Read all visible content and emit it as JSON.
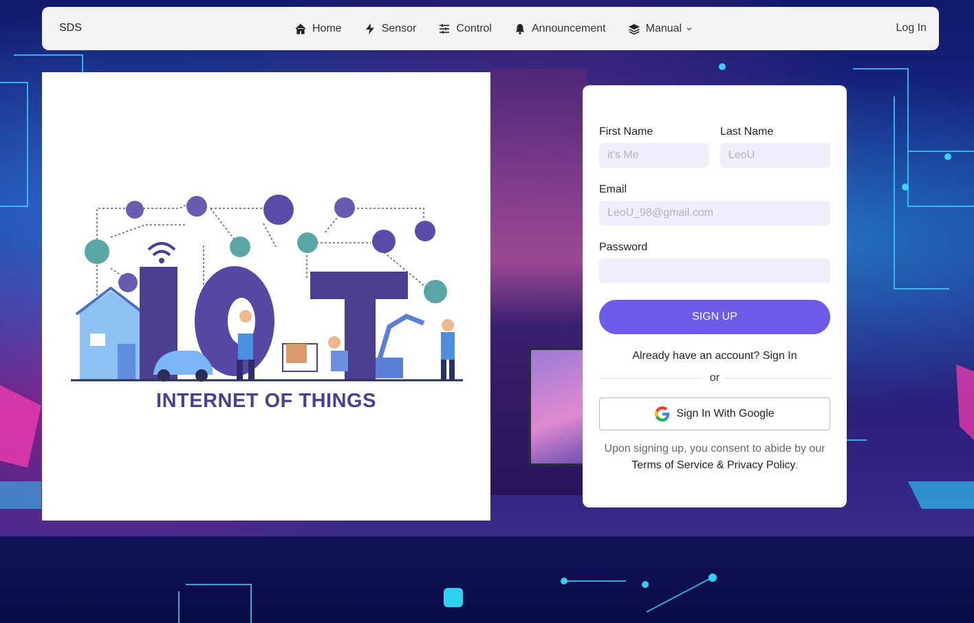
{
  "navbar": {
    "brand": "SDS",
    "items": [
      {
        "label": "Home",
        "icon": "home-icon"
      },
      {
        "label": "Sensor",
        "icon": "bolt-icon"
      },
      {
        "label": "Control",
        "icon": "sliders-icon"
      },
      {
        "label": "Announcement",
        "icon": "bell-icon"
      },
      {
        "label": "Manual",
        "icon": "layers-icon"
      }
    ],
    "login": "Log In"
  },
  "hero": {
    "caption": "INTERNET OF THINGS",
    "logo_text": "IOT"
  },
  "form": {
    "first_name_label": "First Name",
    "first_name_placeholder": "it's Me",
    "last_name_label": "Last Name",
    "last_name_placeholder": "LeoU",
    "email_label": "Email",
    "email_placeholder": "LeoU_98@gmail.com",
    "password_label": "Password",
    "password_value": "",
    "signup_label": "SIGN UP",
    "already_text": "Already have an account? Sign In",
    "or_text": "or",
    "google_label": "Sign In With Google",
    "terms_prefix": "Upon signing up, you consent to abide by our",
    "terms_link": "Terms of Service",
    "terms_amp": "&",
    "privacy_link": "Privacy Policy",
    "terms_suffix": "."
  },
  "colors": {
    "accent": "#6c5ce7",
    "input_bg": "#efeefb",
    "navbar_bg": "#f3f3f6",
    "iot_purple": "#4b3f92"
  }
}
